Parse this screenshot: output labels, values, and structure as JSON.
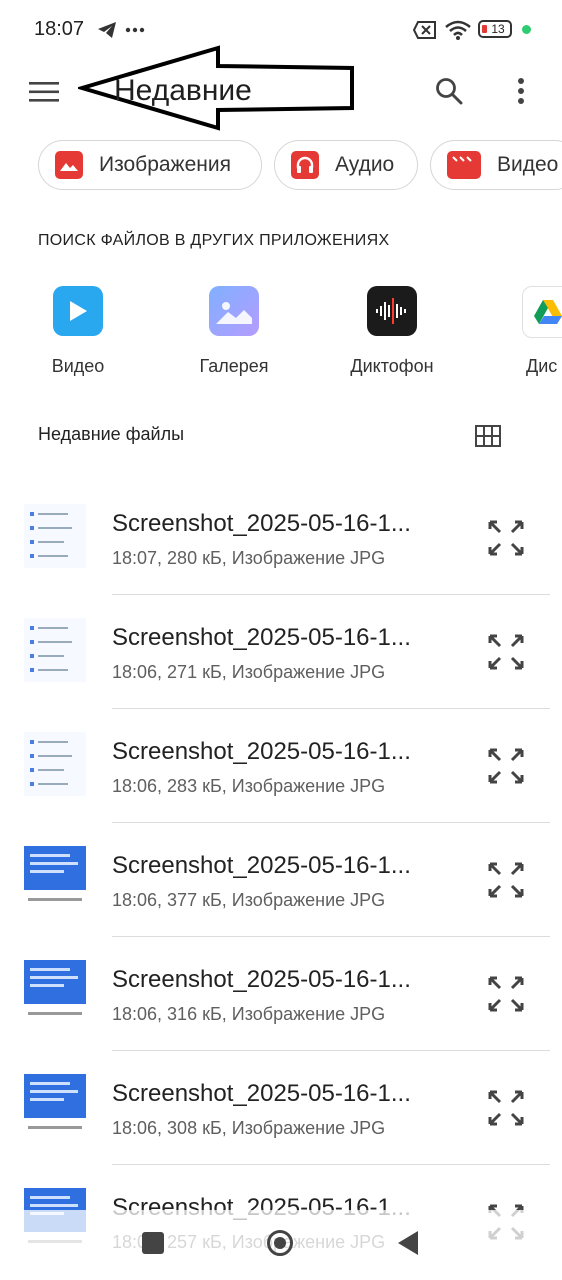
{
  "status_bar": {
    "time": "18:07",
    "battery_level": "13"
  },
  "app_bar": {
    "title": "Недавние"
  },
  "chips": [
    {
      "label": "Изображения",
      "icon": "image-icon"
    },
    {
      "label": "Аудио",
      "icon": "headphones-icon"
    },
    {
      "label": "Видео",
      "icon": "clapperboard-icon"
    }
  ],
  "other_apps": {
    "heading": "ПОИСК ФАЙЛОВ В ДРУГИХ ПРИЛОЖЕНИЯХ",
    "apps": [
      {
        "label": "Видео",
        "icon": "play-icon"
      },
      {
        "label": "Галерея",
        "icon": "gallery-icon"
      },
      {
        "label": "Диктофон",
        "icon": "waveform-icon"
      },
      {
        "label": "Дис",
        "icon": "drive-icon"
      }
    ]
  },
  "recent": {
    "heading": "Недавние файлы",
    "files": [
      {
        "name": "Screenshot_2025-05-16-1...",
        "meta": "18:07, 280 кБ, Изображение JPG"
      },
      {
        "name": "Screenshot_2025-05-16-1...",
        "meta": "18:06, 271 кБ, Изображение JPG"
      },
      {
        "name": "Screenshot_2025-05-16-1...",
        "meta": "18:06, 283 кБ, Изображение JPG"
      },
      {
        "name": "Screenshot_2025-05-16-1...",
        "meta": "18:06, 377 кБ, Изображение JPG"
      },
      {
        "name": "Screenshot_2025-05-16-1...",
        "meta": "18:06, 316 кБ, Изображение JPG"
      },
      {
        "name": "Screenshot_2025-05-16-1...",
        "meta": "18:06, 308 кБ, Изображение JPG"
      },
      {
        "name": "Screenshot_2025-05-16-1...",
        "meta": "18:06, 257 кБ, Изображение JPG"
      }
    ]
  }
}
